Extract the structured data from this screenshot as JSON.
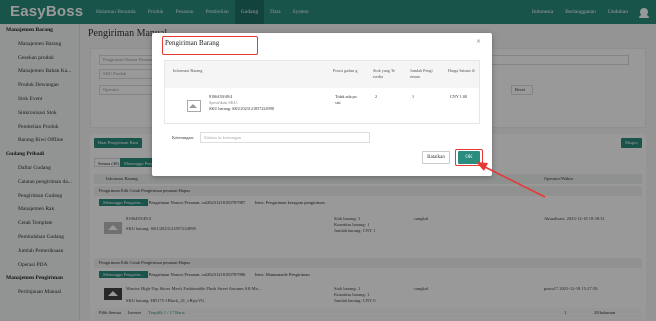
{
  "brand": "EasyBoss",
  "nav": [
    "Halaman Beranda",
    "Produk",
    "Pesanan",
    "Pembelian",
    "Gudang",
    "Data",
    "System"
  ],
  "nav_active_index": 4,
  "topright": {
    "language": "Indonesia",
    "subscription": "Berlangganan",
    "download": "Unduhan"
  },
  "sidebar": [
    {
      "label": "Manajemen Barang",
      "head": true
    },
    {
      "label": "Manajemen Barang"
    },
    {
      "label": "Gesekan produk"
    },
    {
      "label": "Manajemen Bahan Ka..."
    },
    {
      "label": "Produk Dewangan"
    },
    {
      "label": "Stok Event"
    },
    {
      "label": "Sinkronisasi Stok"
    },
    {
      "label": "Pembelian Produk"
    },
    {
      "label": "Barang Riwi Offline"
    },
    {
      "label": "Gudang Pribadi",
      "head": true
    },
    {
      "label": "Daftar Gudang"
    },
    {
      "label": "Catatan pengiriman da..."
    },
    {
      "label": "Pengiriman Gudang"
    },
    {
      "label": "Manajemen Rak"
    },
    {
      "label": "Cetak Template"
    },
    {
      "label": "Pemindahan Gudang"
    },
    {
      "label": "Jumlah Pemeriksaan"
    },
    {
      "label": "Operasi PDA"
    },
    {
      "label": "Manajemen Pengiriman",
      "head": true
    },
    {
      "label": "Pertinjauan Manual"
    }
  ],
  "page": {
    "title": "Pengiriman Manual",
    "filters": {
      "status": "Pengiriman Nomor Pesanan",
      "product": "SKU Produk",
      "operator": "Operator",
      "reset": "Reset"
    },
    "btn_primary": "Buat Pengiriman Baru",
    "tab_all": "Semua (40)",
    "tab_waiting": "Menunggu Peng...",
    "export": "Ekspor",
    "col_info": "Informasi Barang",
    "col_op": "Operator/Waktu",
    "row_actions": "Pengiriman   Edit   Cetak Pengiriman pesanan   Hapus",
    "order1": {
      "status": "Menunggu Pengirim...",
      "number": "Pengiriman Nomor Pesanan: cnl20231218183787987",
      "note": "Jenis: Pengiriman keragam pengiriman",
      "id": "8186439/49/4",
      "sku": "SKU barang:  SKU2023121857224998",
      "stock": "Stok barang:  1",
      "qty": "Kuantitas barang:  1",
      "total": "Jumlah barang:  CNY 1",
      "wh": "cangkul",
      "op": "Aktualisasi: 2023-12-18 18:38:31"
    },
    "order2": {
      "status": "Menunggu Pengirim...",
      "number": "Pengiriman Nomor Pesanan: cnl20231218183787986",
      "note": "Jenis: Manusnaide Pengiriman",
      "name": "Warrior High-Top Shoes Men's Fashionable Plush Street Autumn All-Ma...",
      "sku": "SKU barang:  HD175-1Black_41_vBjzyVG",
      "stock": "Stok barang:  1",
      "qty": "Kuantitas barang:  1",
      "total": "Jumlah barang:  CNY 0",
      "wh": "cangkul",
      "op": "pustu17 2023-12-18 15:27:58"
    },
    "pagination": {
      "per_page": "Pilih Semua",
      "reverse": "Inverse",
      "selected": "Terpilih 1 / 17 Baris",
      "page": "1",
      "size": "20/halaman"
    }
  },
  "modal": {
    "title": "Pengiriman Barang",
    "close": "×",
    "headers": [
      "Informasi Barang",
      "Posisi gudan g",
      "Stok yang Te rsedia",
      "Jumlah Pengi riman",
      "Harga Satuan ⊙"
    ],
    "item": {
      "id": "8186439/49/4",
      "spec": "Spesifikasi SKU:",
      "sku": "SKU barang:  SKU2023121857224998",
      "position": "Tidak ada po sisi",
      "stock": "2",
      "qty": "1",
      "price": "CNY 1.00"
    },
    "notes_label": "Keterangan:",
    "notes_placeholder": "Silakan isi keterangan",
    "cancel": "Batalkan",
    "ok": "OK"
  }
}
